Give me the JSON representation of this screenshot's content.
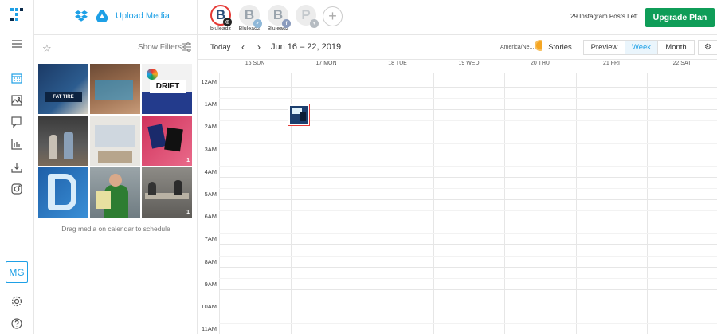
{
  "nav": {
    "items": [
      "calendar-icon",
      "gallery-icon",
      "chat-icon",
      "analytics-icon",
      "download-icon",
      "instagram-icon"
    ],
    "avatar_initials": "MG"
  },
  "media_panel": {
    "upload_label": "Upload Media",
    "show_filters_label": "Show Filters",
    "drag_hint": "Drag media on calendar to schedule",
    "thumbnails": [
      {
        "badge": ""
      },
      {
        "badge": ""
      },
      {
        "badge": ""
      },
      {
        "badge": ""
      },
      {
        "badge": ""
      },
      {
        "badge": "1"
      },
      {
        "badge": ""
      },
      {
        "badge": ""
      },
      {
        "badge": "1"
      }
    ]
  },
  "profiles": [
    {
      "name": "bluleadz",
      "network": "instagram",
      "active": true
    },
    {
      "name": "Bluleadz",
      "network": "twitter",
      "active": false
    },
    {
      "name": "Bluleadz",
      "network": "facebook",
      "active": false
    },
    {
      "name": "",
      "network": "pinterest",
      "active": false
    }
  ],
  "header": {
    "posts_left": "29 Instagram Posts Left",
    "upgrade_label": "Upgrade Plan"
  },
  "calendar": {
    "today_label": "Today",
    "prev_symbol": "‹",
    "next_symbol": "›",
    "range": "Jun 16 – 22, 2019",
    "timezone": "America/Ne...",
    "stories_label": "Stories",
    "view_buttons": [
      "Preview",
      "Week",
      "Month"
    ],
    "active_view": "Week",
    "days": [
      "16 SUN",
      "17 MON",
      "18 TUE",
      "19 WED",
      "20 THU",
      "21 FRI",
      "22 SAT"
    ],
    "hours": [
      "12AM",
      "1AM",
      "2AM",
      "3AM",
      "4AM",
      "5AM",
      "6AM",
      "7AM",
      "8AM",
      "9AM",
      "10AM",
      "11AM"
    ]
  },
  "colors": {
    "accent": "#1ea0e6",
    "upgrade": "#0f9d58",
    "event_border": "#e53935",
    "timezone_dot": "#f5a623"
  }
}
